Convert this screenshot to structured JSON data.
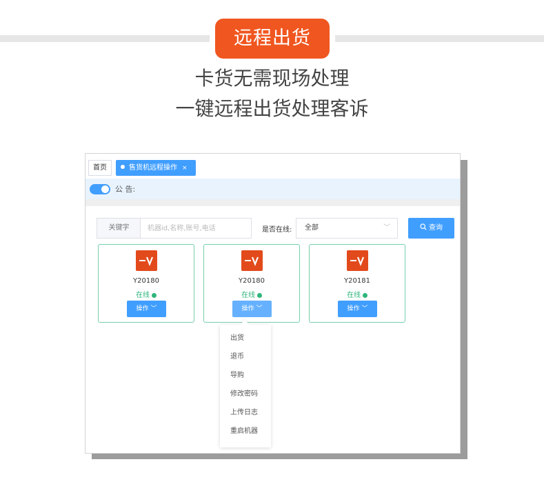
{
  "banner": {
    "title": "远程出货",
    "subtitle_line1": "卡货无需现场处理",
    "subtitle_line2": "一键远程出货处理客诉",
    "accent_color": "#f0561f"
  },
  "app": {
    "tabs": {
      "home_label": "首页",
      "active_label": "售货机远程操作",
      "close_glyph": "×"
    },
    "notice": {
      "label": "公 告:",
      "toggle_on": true
    },
    "filters": {
      "keyword_label": "关键字",
      "keyword_placeholder": "机器id,名称,账号,电话",
      "online_label": "是否在线:",
      "online_value": "全部",
      "query_button": "查询"
    },
    "machines": [
      {
        "code": "Y20180",
        "status": "在线",
        "action_label": "操作"
      },
      {
        "code": "Y20180",
        "status": "在线",
        "action_label": "操作"
      },
      {
        "code": "Y20181",
        "status": "在线",
        "action_label": "操作"
      }
    ],
    "action_menu": {
      "items": [
        "出货",
        "退币",
        "导购",
        "修改密码",
        "上传日志",
        "重启机器"
      ]
    },
    "colors": {
      "primary": "#409eff",
      "online_green": "#2fb57b",
      "card_border": "#74cfa7",
      "logo_orange": "#e24a1c"
    }
  }
}
